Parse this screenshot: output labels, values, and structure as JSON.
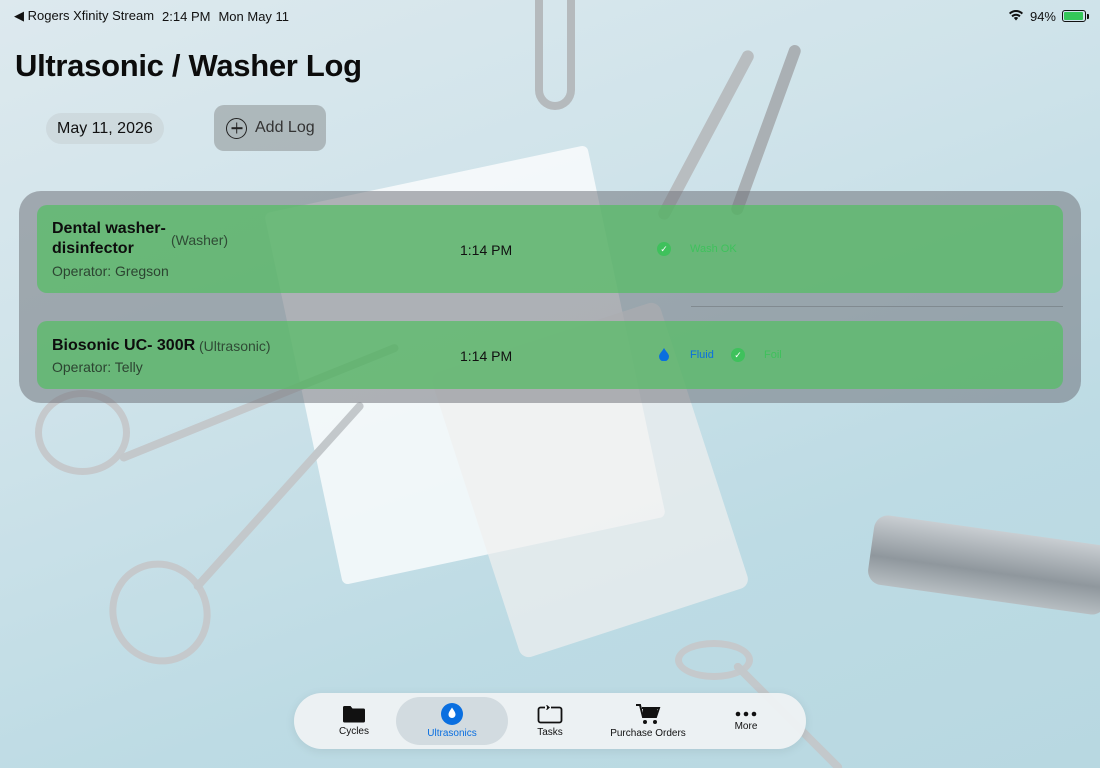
{
  "status_bar": {
    "back_app": "◀ Rogers Xfinity Stream",
    "time": "2:14 PM",
    "date": "Mon May 11",
    "battery": "94%"
  },
  "page": {
    "title": "Ultrasonic / Washer Log",
    "date_filter": "May 11, 2026",
    "add_log_label": "Add Log"
  },
  "logs": [
    {
      "name_line1": "Dental washer-",
      "name_line2": "disinfector",
      "type": "(Washer)",
      "operator": "Operator: Gregson",
      "time": "1:14 PM",
      "status_label": "Wash OK"
    },
    {
      "name": "Biosonic UC- 300R",
      "type": "(Ultrasonic)",
      "operator": "Operator: Telly",
      "time": "1:14 PM",
      "fluid_label": "Fluid",
      "foil_label": "Foil"
    }
  ],
  "tabs": [
    {
      "label": "Cycles",
      "icon": "folder-icon"
    },
    {
      "label": "Ultrasonics",
      "icon": "water-drop-icon"
    },
    {
      "label": "Tasks",
      "icon": "repeat-task-icon"
    },
    {
      "label": "Purchase Orders",
      "icon": "cart-icon"
    },
    {
      "label": "More",
      "icon": "ellipsis-icon"
    }
  ],
  "colors": {
    "accent": "#0a6fe0",
    "success": "#3fc15c",
    "row_background": "#55be64"
  }
}
